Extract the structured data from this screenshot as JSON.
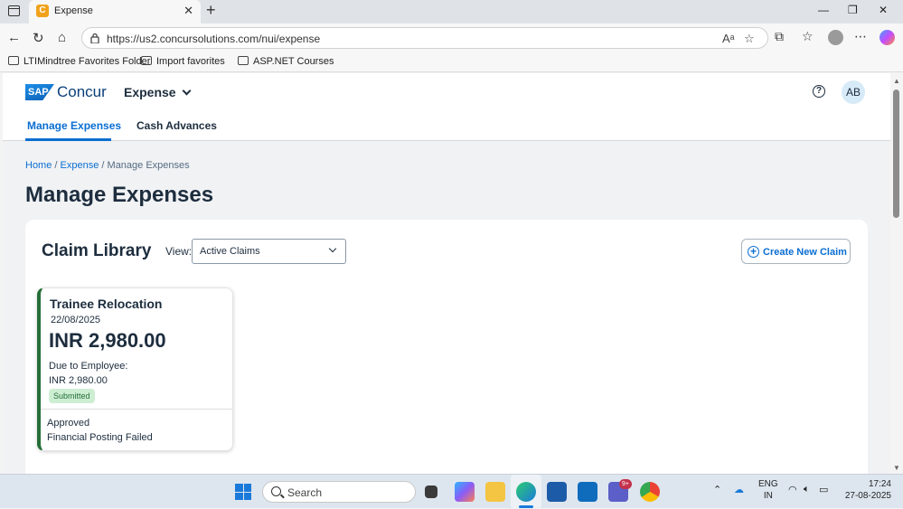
{
  "browser": {
    "tab_title": "Expense",
    "url": "https://us2.concursolutions.com/nui/expense",
    "favorites": [
      "LTIMindtree Favorites Folder",
      "Import favorites",
      "ASP.NET Courses"
    ]
  },
  "app": {
    "logo_badge": "SAP",
    "logo_text": "Concur",
    "product": "Expense",
    "avatar_initials": "AB",
    "tabs": [
      {
        "label": "Manage Expenses",
        "active": true
      },
      {
        "label": "Cash Advances",
        "active": false
      }
    ]
  },
  "breadcrumb": {
    "home": "Home",
    "expense": "Expense",
    "current": "Manage Expenses",
    "sep": "/"
  },
  "page": {
    "title": "Manage Expenses"
  },
  "library": {
    "title": "Claim Library",
    "view_label": "View:",
    "view_value": "Active Claims",
    "create_label": "Create New Claim"
  },
  "claims": [
    {
      "title": "Trainee Relocation",
      "date": "22/08/2025",
      "amount": "INR 2,980.00",
      "due_label": "Due to Employee:",
      "due_amount": "INR 2,980.00",
      "badge": "Submitted",
      "status_line1": "Approved",
      "status_line2": "Financial Posting Failed"
    }
  ],
  "taskbar": {
    "search_placeholder": "Search",
    "lang_line1": "ENG",
    "lang_line2": "IN",
    "time": "17:24",
    "date": "27-08-2025",
    "teams_badge": "9+"
  },
  "colors": {
    "accent": "#0a6ed1",
    "text": "#1d2d3e",
    "card_border": "#256f3a",
    "badge_bg": "#cdeed2"
  }
}
